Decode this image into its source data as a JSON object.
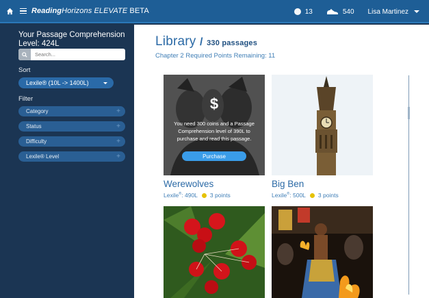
{
  "topbar": {
    "brand_part1": "Reading",
    "brand_part2": "Horizons",
    "brand_part3": " ELEVATE",
    "brand_part4": " BETA",
    "coins": "13",
    "points": "540",
    "user_name": "Lisa Martinez"
  },
  "sidebar": {
    "title": "Your Passage Comprehension Level: 424L",
    "search_placeholder": "Search...",
    "sort_label": "Sort",
    "sort_value": "Lexile® (10L -> 1400L)",
    "filter_label": "Filter",
    "filters": [
      "Category",
      "Status",
      "Difficulty",
      "Lexile® Level"
    ]
  },
  "main": {
    "title": "Library",
    "slash": "/",
    "count": "330 passages",
    "required_points": "Chapter 2 Required Points Remaining: 11"
  },
  "cards": [
    {
      "title": "Werewolves",
      "lexile_prefix": "Lexile",
      "lexile_sup": "®",
      "lexile_value": ": 490L",
      "points": "3 points",
      "locked": true,
      "lock_symbol": "$",
      "lock_text": "You need 300 coins and a Passage Comprehension level of 390L to purchase and read this passage.",
      "purchase_label": "Purchase"
    },
    {
      "title": "Big Ben",
      "lexile_prefix": "Lexile",
      "lexile_sup": "®",
      "lexile_value": ": 500L",
      "points": "3 points",
      "locked": false
    }
  ],
  "colors": {
    "topbar": "#1e5e96",
    "sidebar": "#1b3553",
    "accent": "#2b6aa6",
    "points_dot": "#e6c200",
    "purchase": "#3a9ce8"
  }
}
